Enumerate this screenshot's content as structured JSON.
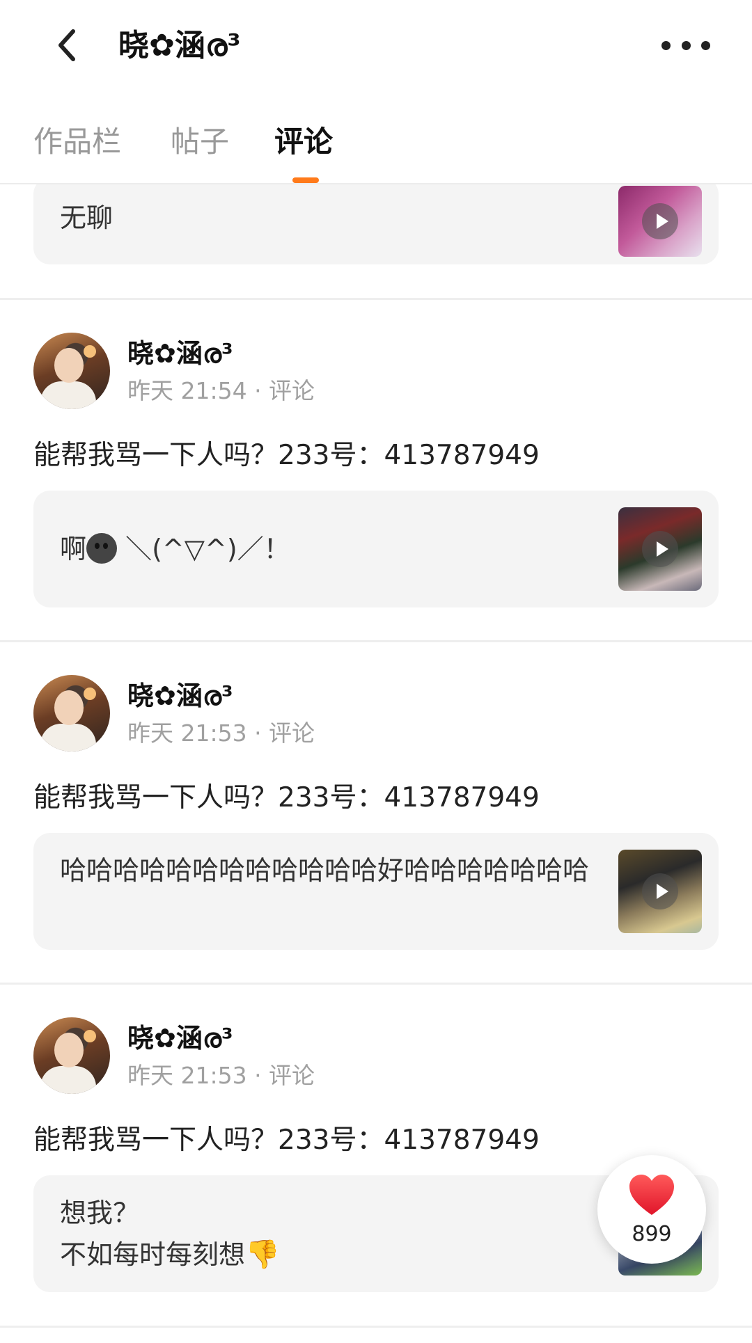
{
  "header": {
    "back_icon": "chevron-left-icon",
    "title": "晓✿涵ര³",
    "more_icon": "more-horizontal-icon"
  },
  "tabs": [
    {
      "label": "作品栏",
      "active": false
    },
    {
      "label": "帖子",
      "active": false
    },
    {
      "label": "评论",
      "active": true
    }
  ],
  "accent_color": "#ff7a1a",
  "feed": {
    "top_partial": {
      "quote": "无聊"
    },
    "items": [
      {
        "username": "晓✿涵ര³",
        "meta": "昨天 21:54 · 评论",
        "text": "能帮我骂一下人吗？233号：413787949",
        "quote_prefix": "啊",
        "quote_suffix": "＼(^▽^)／！"
      },
      {
        "username": "晓✿涵ര³",
        "meta": "昨天 21:53 · 评论",
        "text": "能帮我骂一下人吗？233号：413787949",
        "quote": "哈哈哈哈哈哈哈哈哈哈哈哈好哈哈哈哈哈哈哈"
      },
      {
        "username": "晓✿涵ര³",
        "meta": "昨天 21:53 · 评论",
        "text": "能帮我骂一下人吗？233号：413787949",
        "quote_line1": "想我？",
        "quote_line2": "不如每时每刻想"
      }
    ]
  },
  "like": {
    "count": "899",
    "icon": "heart-icon"
  }
}
